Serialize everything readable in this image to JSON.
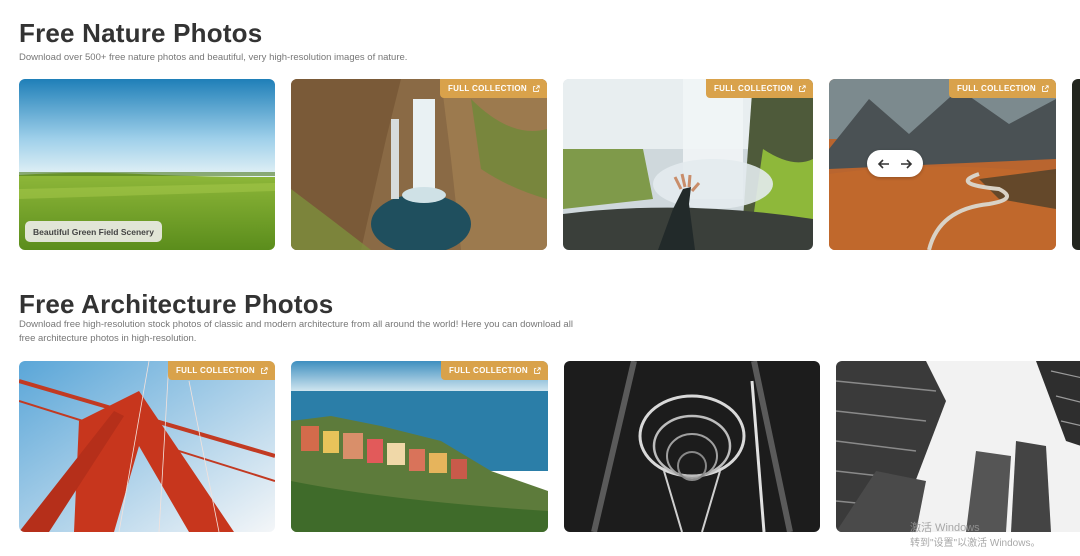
{
  "nature": {
    "title": "Free Nature Photos",
    "description": "Download over 500+ free nature photos and beautiful, very high-resolution images of nature.",
    "cards": [
      {
        "name": "green-field",
        "caption": "Beautiful Green Field Scenery"
      },
      {
        "name": "waterfall-aerial",
        "badge": "FULL COLLECTION"
      },
      {
        "name": "waterfall-hand",
        "badge": "FULL COLLECTION"
      },
      {
        "name": "mountain-road",
        "badge": "FULL COLLECTION"
      }
    ]
  },
  "architecture": {
    "title": "Free Architecture Photos",
    "description": "Download free high-resolution stock photos of classic and modern architecture from all around the world! Here you can download all free architecture photos in high-resolution.",
    "cards": [
      {
        "name": "red-bridge",
        "badge": "FULL COLLECTION"
      },
      {
        "name": "coastal-village",
        "badge": "FULL COLLECTION"
      },
      {
        "name": "spiral-staircase"
      },
      {
        "name": "skyscrapers"
      }
    ]
  },
  "watermark": {
    "line1": "激活 Windows",
    "line2": "转到\"设置\"以激活 Windows。"
  },
  "icons": {
    "badge_icon": "external-link-icon",
    "prev": "arrow-left-icon",
    "next": "arrow-right-icon"
  },
  "colors": {
    "badge": "#d9a24b",
    "title": "#333333",
    "description": "#777777"
  }
}
